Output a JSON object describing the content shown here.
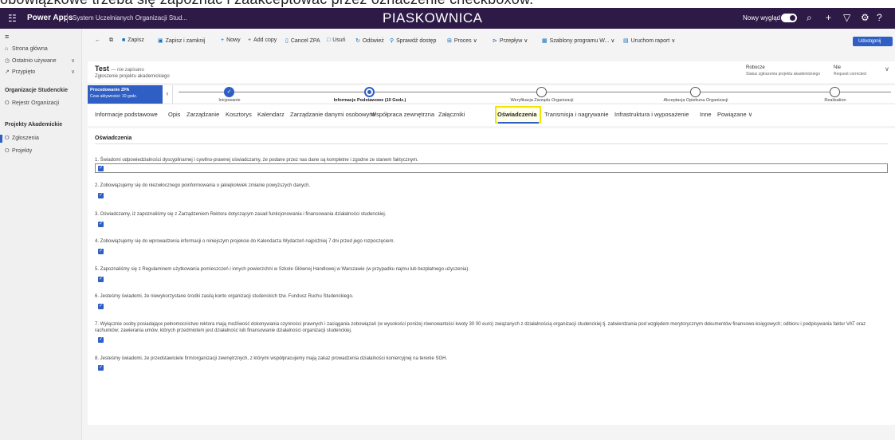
{
  "caption": "obowiązkowe trzeba się zapoznać i zaakceptować przez oznaczenie checkboxów.",
  "topbar": {
    "app_name": "Power Apps",
    "env_name": "System Uczelnianych Organizacji Stud...",
    "sandbox": "PIASKOWNICA",
    "new_look": "Nowy wygląd"
  },
  "sidebar": {
    "home": "Strona główna",
    "recent": "Ostatnio używane",
    "pinned": "Przypięto",
    "group1": "Organizacje Studenckie",
    "registry": "Rejestr Organizacji",
    "group2": "Projekty Akademickie",
    "submissions": "Zgłoszenia",
    "projects": "Projekty"
  },
  "commands": {
    "save": "Zapisz",
    "save_close": "Zapisz i zamknij",
    "new": "Nowy",
    "add_copy": "Add copy",
    "cancel": "Cancel ZPA",
    "delete": "Usuń",
    "refresh": "Odśwież",
    "check_access": "Sprawdź dostęp",
    "process": "Proces",
    "flow": "Przepływ",
    "templates": "Szablony programu W...",
    "report": "Uruchom raport",
    "share": "Udostępnij"
  },
  "record": {
    "title": "Test",
    "unsaved": "— nie zapisano",
    "subtitle": "Zgłoszenie projektu akademickiego",
    "status_value": "Robocze",
    "status_label": "Status zgłoszenia projektu akademickiego",
    "rc_value": "Nie",
    "rc_label": "Request corrected"
  },
  "bpf": {
    "active_title": "Procedowanie ZPA",
    "active_sub": "Czas aktywności: 10 godz.",
    "stages": [
      "Inicjowanie",
      "Informacje Podstawowe  (10 Godz.)",
      "Weryfikacja Zarządu Organizacji",
      "Akceptacja Opiekuna Organizacji",
      "Realisation"
    ]
  },
  "tabs": [
    "Informacje podstawowe",
    "Opis",
    "Zarządzanie",
    "Kosztorys",
    "Kalendarz",
    "Zarządzanie danymi osobowymi",
    "Współpraca zewnętrzna",
    "Załączniki",
    "Oświadczenia",
    "Transmisja i nagrywanie",
    "Infrastruktura i wyposażenie",
    "Inne",
    "Powiązane"
  ],
  "section": {
    "title": "Oświadczenia",
    "questions": [
      "1. Świadomi odpowiedzialności dyscyplinarnej i cywilno-prawnej oświadczamy, że podane przez nas dane są kompletne i zgodne ze stanem faktycznym.",
      "2. Zobowiązujemy się do niezwłocznego poinformowania o jakiejkolwiek zmianie powyższych danych.",
      "3. Oświadczamy, iż zapoznaliśmy się z Zarządzeniem Rektora dotyczącym zasad funkcjonowania i finansowania działalności studenckiej.",
      "4. Zobowiązujemy się do wprowadzenia informacji o niniejszym projekcie do Kalendarza Wydarzeń najpóźniej 7 dni przed jego rozpoczęciem.",
      "5. Zapoznaliśmy się z Regulaminem użytkowania pomieszczeń i innych powierzchni w Szkole Głównej Handlowej w Warszawie (w przypadku najmu lub bezpłatnego użyczenia).",
      "6. Jesteśmy świadomi, że niewykorzystane środki zasilą konto organizacji studenckich tzw. Fundusz Ruchu Studenckiego.",
      "7. Wyłącznie osoby posiadające pełnomocnictwo rektora mają możliwość dokonywania czynności prawnych i zaciągania zobowiązań (w wysokości poniżej równowartości kwoty 30 00 euro) związanych z działalnością organizacji studenckiej tj. zatwierdzania pod względem merytorycznym dokumentów finansowo-księgowych; odbioru i podpisywania faktur VAT oraz rachunków; zawierania umów, których przedmiotem jest działalność lub finansowanie działalności organizacji studenckiej.",
      "8. Jesteśmy świadomi, że przedstawiciele firm/organizacji zewnętrznych, z którymi współpracujemy mają zakaz prowadzenia działalności komercyjnej na terenie SGH."
    ]
  },
  "colors": {
    "topbar": "#2e1a47",
    "accent": "#2f5fc4",
    "highlight": "#f2e600"
  }
}
